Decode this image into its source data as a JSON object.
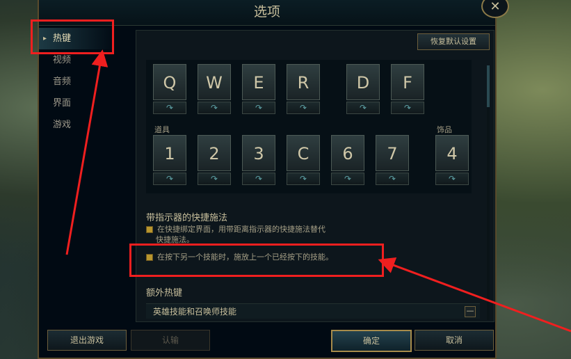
{
  "title": "选项",
  "close_icon": "close-icon",
  "nav": {
    "items": [
      {
        "label": "热键",
        "active": true
      },
      {
        "label": "视频",
        "active": false
      },
      {
        "label": "音频",
        "active": false
      },
      {
        "label": "界面",
        "active": false
      },
      {
        "label": "游戏",
        "active": false
      }
    ]
  },
  "content": {
    "reset_label": "恢复默认设置",
    "ability_keys": [
      "Q",
      "W",
      "E",
      "R",
      "D",
      "F"
    ],
    "item_group_label": "道具",
    "item_keys": [
      "1",
      "2",
      "3",
      "C",
      "6",
      "7"
    ],
    "trinket_group_label": "饰品",
    "trinket_key": "4",
    "slot_glyph": "↷",
    "indicator_section_title": "带指示器的快捷施法",
    "option1_text_line1": "在快捷绑定界面，用带距离指示器的快捷施法替代",
    "option1_text_line2": "快捷施法。",
    "option2_text": "在按下另一个技能时，施放上一个已经按下的技能。",
    "extra_section_title": "额外热键",
    "collapse_row_label": "英雄技能和召唤师技能",
    "collapse_symbol": "—"
  },
  "footer": {
    "exit_label": "退出游戏",
    "surrender_label": "认输",
    "confirm_label": "确定",
    "cancel_label": "取消"
  },
  "colors": {
    "accent_gold": "#c8bf9c",
    "annotation_red": "#f01f1f",
    "checkbox_gold": "#b8962e"
  }
}
